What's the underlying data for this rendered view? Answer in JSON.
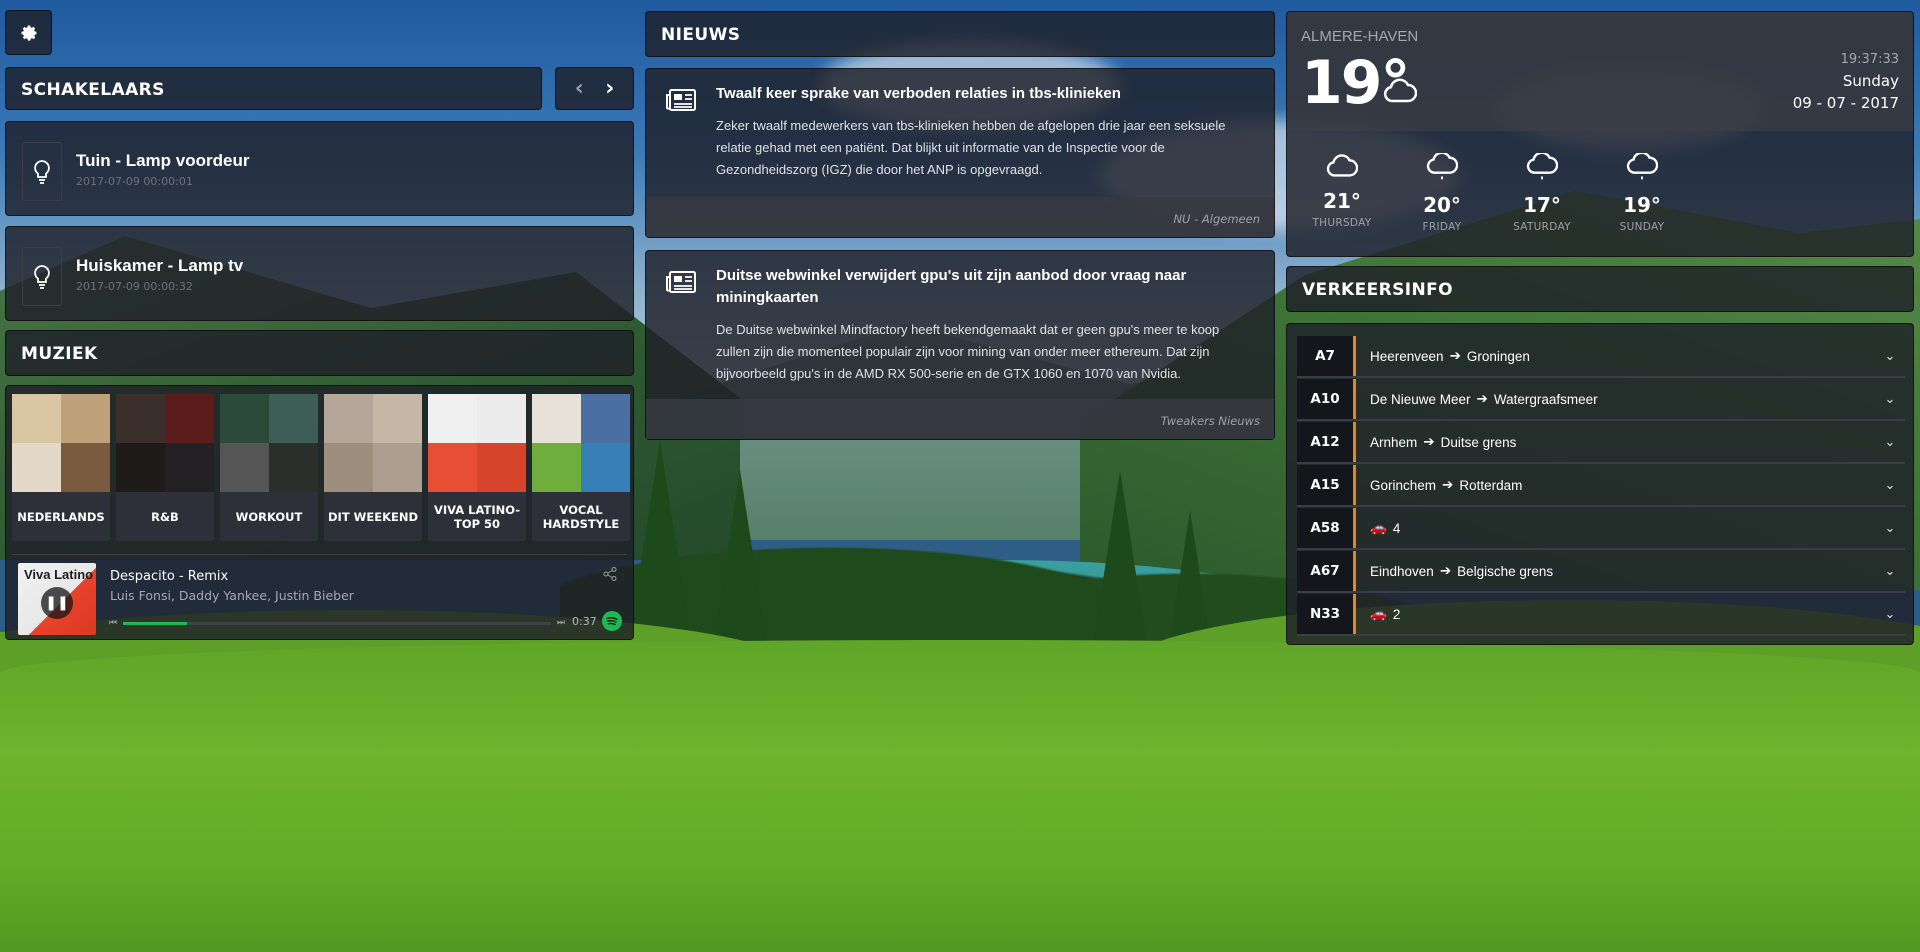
{
  "switches": {
    "header": "SCHAKELAARS",
    "items": [
      {
        "name": "Tuin - Lamp voordeur",
        "time": "2017-07-09 00:00:01"
      },
      {
        "name": "Huiskamer - Lamp tv",
        "time": "2017-07-09 00:00:32"
      }
    ]
  },
  "music": {
    "header": "MUZIEK",
    "playlists": [
      {
        "label": "NEDERLANDS",
        "colors": [
          "#d9c6a2",
          "#c0a27a",
          "#e4d8c8",
          "#7a5b3d"
        ]
      },
      {
        "label": "R&B",
        "colors": [
          "#3a2f2a",
          "#5b1c1c",
          "#1f1b19",
          "#242124"
        ]
      },
      {
        "label": "WORKOUT",
        "colors": [
          "#2b4a3a",
          "#3d5e55",
          "#555555",
          "#2a2f2c"
        ]
      },
      {
        "label": "DIT WEEKEND",
        "colors": [
          "#b4a79a",
          "#c4b7a8",
          "#9e8e7e",
          "#ad9f90"
        ]
      },
      {
        "label": "VIVA LATINO-\nTOP 50",
        "colors": [
          "#f0f0f0",
          "#ececec",
          "#e84e33",
          "#d8442b"
        ]
      },
      {
        "label": "VOCAL\nHARDSTYLE",
        "colors": [
          "#e7e2d7",
          "#4b6fa3",
          "#6fae3d",
          "#3780b7"
        ]
      }
    ],
    "now_playing": {
      "title": "Despacito - Remix",
      "artists": "Luis Fonsi, Daddy Yankee, Justin Bieber",
      "cover_text": "Viva Latino",
      "elapsed": "0:37",
      "progress_fraction": 0.15
    }
  },
  "news": {
    "header": "NIEUWS",
    "items": [
      {
        "title": "Twaalf keer sprake van verboden relaties in tbs-klinieken",
        "body": "Zeker twaalf medewerkers van tbs-klinieken hebben de afgelopen drie jaar een seksuele relatie gehad met een patiënt. Dat blijkt uit informatie van de Inspectie voor de Gezondheidszorg (IGZ) die door het ANP is opgevraagd.",
        "source": "NU - Algemeen"
      },
      {
        "title": "Duitse webwinkel verwijdert gpu's uit zijn aanbod door vraag naar miningkaarten",
        "body": "De Duitse webwinkel Mindfactory heeft bekendgemaakt dat er geen gpu's meer te koop zullen zijn die momenteel populair zijn voor mining van onder meer ethereum. Dat zijn bijvoorbeeld gpu's in de AMD RX 500-serie en de GTX 1060 en 1070 van Nvidia.",
        "source": "Tweakers Nieuws"
      }
    ]
  },
  "weather": {
    "location": "ALMERE-HAVEN",
    "temp": "19°",
    "clock": "19:37:33",
    "day": "Sunday",
    "date": "09 - 07 - 2017",
    "forecast": [
      {
        "temp": "21°",
        "day": "THURSDAY"
      },
      {
        "temp": "20°",
        "day": "FRIDAY"
      },
      {
        "temp": "17°",
        "day": "SATURDAY"
      },
      {
        "temp": "19°",
        "day": "SUNDAY"
      }
    ]
  },
  "traffic": {
    "header": "VERKEERSINFO",
    "accent": "#e2861d",
    "items": [
      {
        "road": "A7",
        "from": "Heerenveen",
        "to": "Groningen"
      },
      {
        "road": "A10",
        "from": "De Nieuwe Meer",
        "to": "Watergraafsmeer"
      },
      {
        "road": "A12",
        "from": "Arnhem",
        "to": "Duitse grens"
      },
      {
        "road": "A15",
        "from": "Gorinchem",
        "to": "Rotterdam"
      },
      {
        "road": "A58",
        "car_count": "4"
      },
      {
        "road": "A67",
        "from": "Eindhoven",
        "to": "Belgische grens"
      },
      {
        "road": "N33",
        "car_count": "2"
      }
    ]
  }
}
